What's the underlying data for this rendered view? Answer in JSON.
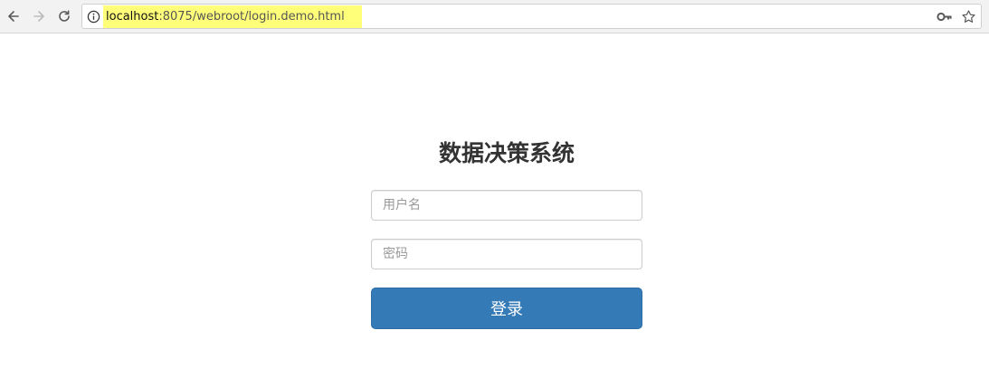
{
  "browser": {
    "url_host": "localhost",
    "url_rest": ":8075/webroot/login.demo.html",
    "icons": {
      "back": "arrow-left-icon",
      "forward": "arrow-right-icon",
      "reload": "reload-icon",
      "info": "info-icon",
      "key": "key-icon",
      "bookmark": "star-icon"
    },
    "highlight_color": "#ffff7a"
  },
  "login": {
    "title": "数据决策系统",
    "username_placeholder": "用户名",
    "password_placeholder": "密码",
    "submit_label": "登录"
  },
  "colors": {
    "primary": "#337ab7",
    "title": "#333333"
  }
}
